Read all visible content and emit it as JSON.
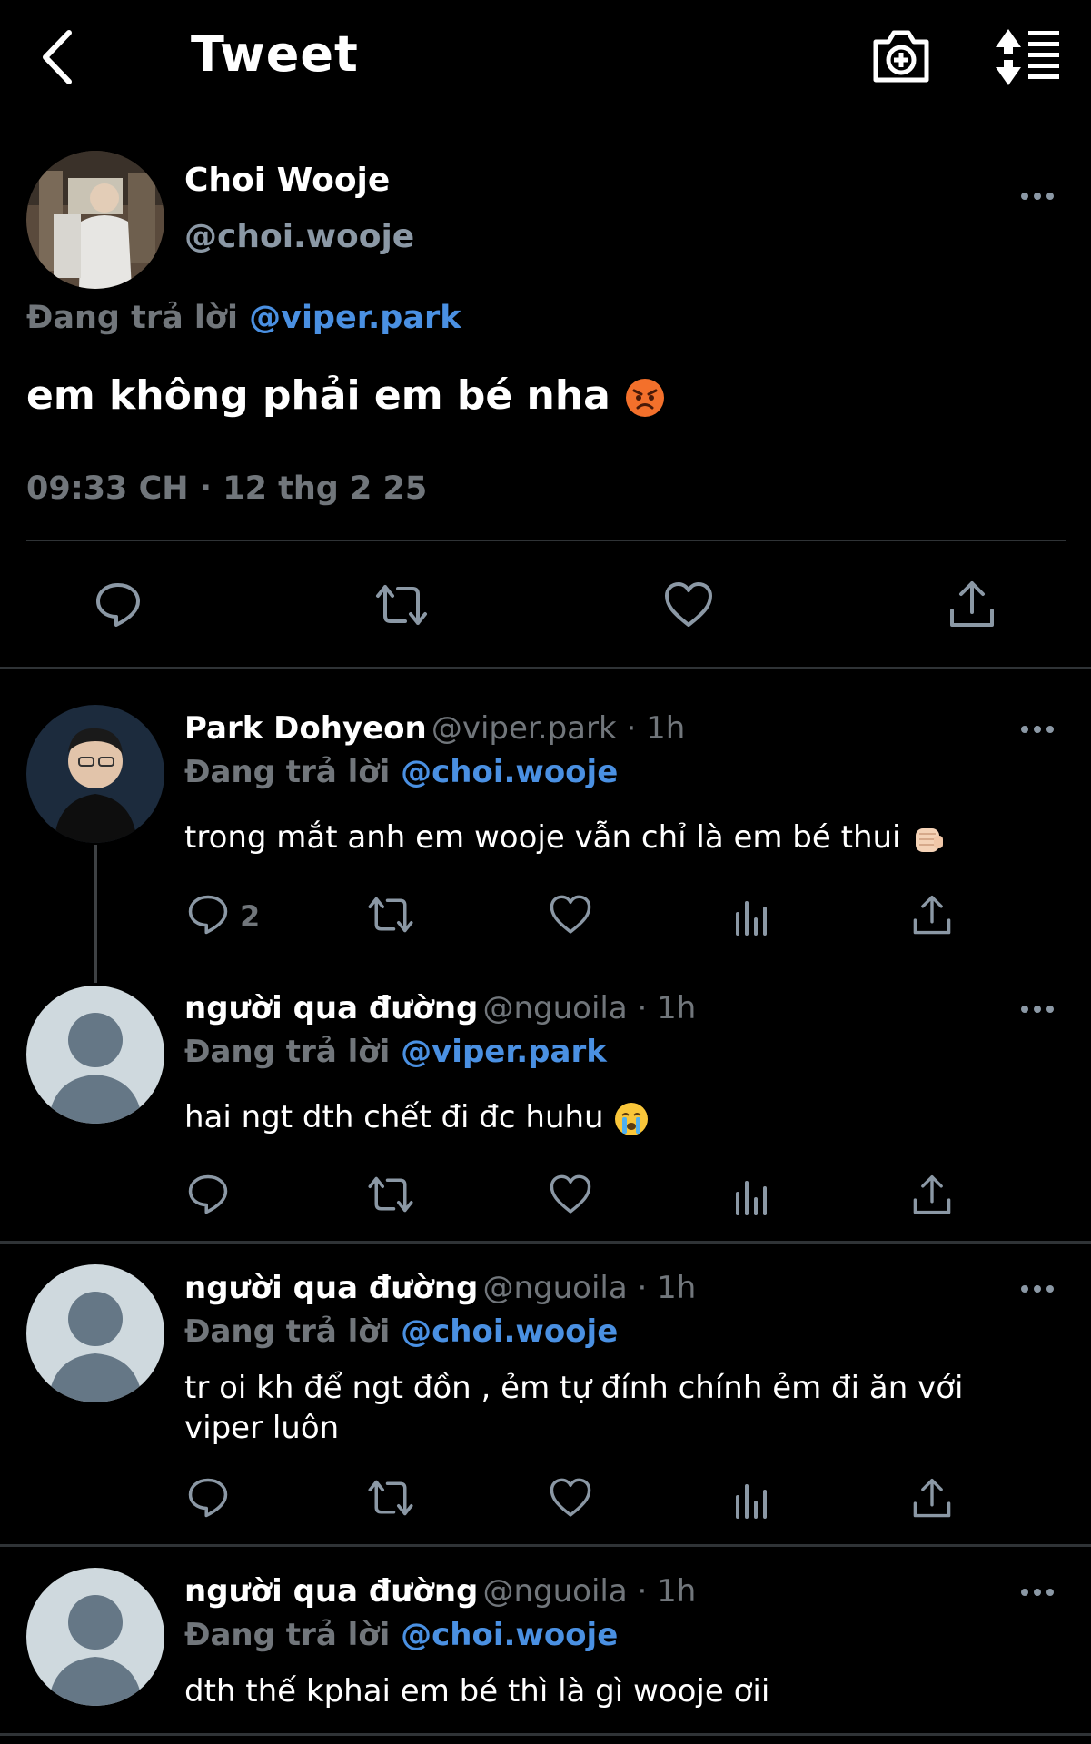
{
  "header": {
    "title": "Tweet"
  },
  "main_tweet": {
    "name": "Choi Wooje",
    "handle": "@choi.wooje",
    "replying_prefix": "Đang trả lời",
    "replying_to": "@viper.park",
    "text": "em không phải em bé nha",
    "timestamp": "09:33 CH · 12 thg 2 25"
  },
  "replies": [
    {
      "name": "Park Dohyeon",
      "meta": "@viper.park · 1h",
      "replying_prefix": "Đang trả lời",
      "replying_to": "@choi.wooje",
      "text": "trong mắt anh em wooje vẫn chỉ là em bé thui",
      "reply_count": "2"
    },
    {
      "name": "người qua đường",
      "meta": "@nguoila · 1h",
      "replying_prefix": "Đang trả lời",
      "replying_to": "@viper.park",
      "text": "hai ngt dth chết đi đc huhu"
    },
    {
      "name": "người qua đường",
      "meta": "@nguoila · 1h",
      "replying_prefix": "Đang trả lời",
      "replying_to": "@choi.wooje",
      "text": "tr oi kh để ngt đồn , ẻm tự đính chính ẻm đi ăn với viper luôn"
    },
    {
      "name": "người qua đường",
      "meta": "@nguoila · 1h",
      "replying_prefix": "Đang trả lời",
      "replying_to": "@choi.wooje",
      "text": "dth thế kphai em bé thì là gì wooje ơii"
    }
  ],
  "colors": {
    "background": "#000000",
    "mention": "#4a90e2",
    "muted": "#71767b"
  },
  "icons": [
    "back-arrow-icon",
    "add-camera-icon",
    "sort-icon",
    "more-icon",
    "reply-icon",
    "retweet-icon",
    "like-icon",
    "share-icon",
    "views-icon",
    "angry-emoji",
    "fist-emoji",
    "crying-emoji"
  ]
}
